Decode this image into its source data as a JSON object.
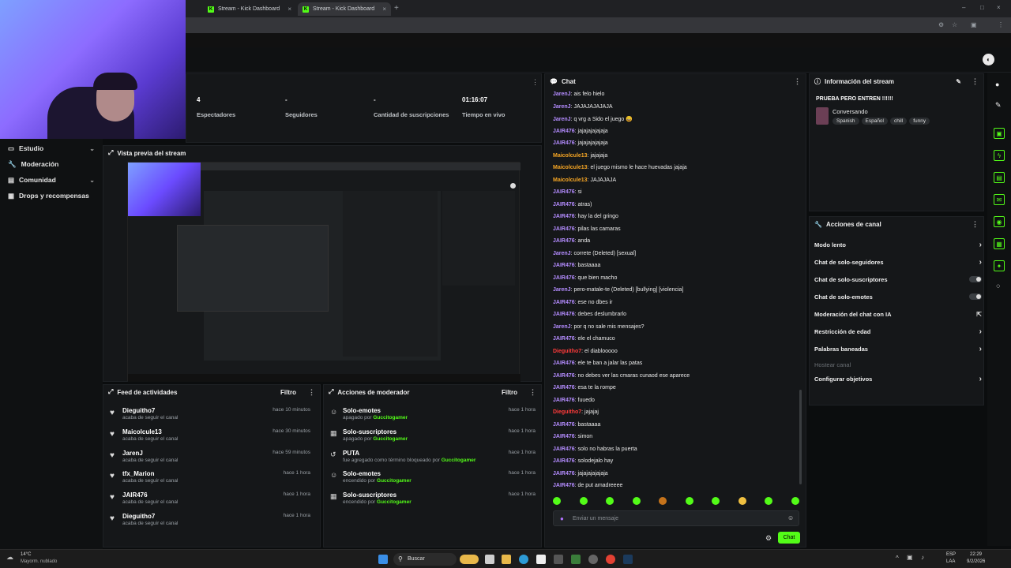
{
  "browser": {
    "tabs": [
      {
        "label": "Stream - Kick Dashboard"
      },
      {
        "label": "Stream - Kick Dashboard"
      }
    ]
  },
  "sidebar": {
    "items": [
      {
        "label": "Estudio",
        "chevron": "⌄"
      },
      {
        "label": "Moderación"
      },
      {
        "label": "Comunidad",
        "chevron": "⌄"
      },
      {
        "label": "Drops y recompensas"
      }
    ]
  },
  "stats": [
    {
      "value": "4",
      "label": "Espectadores"
    },
    {
      "value": "-",
      "label": "Seguidores"
    },
    {
      "value": "-",
      "label": "Cantidad de suscripciones"
    },
    {
      "value": "01:16:07",
      "label": "Tiempo en vivo"
    }
  ],
  "preview": {
    "title": "Vista previa del stream"
  },
  "feed": {
    "title": "Feed de actividades",
    "filter": "Filtro",
    "items": [
      {
        "name": "Dieguitho7",
        "sub": "acaba de seguir el canal",
        "time": "hace 10 minutos"
      },
      {
        "name": "Maicolcule13",
        "sub": "acaba de seguir el canal",
        "time": "hace 30 minutos"
      },
      {
        "name": "JarenJ",
        "sub": "acaba de seguir el canal",
        "time": "hace 59 minutos"
      },
      {
        "name": "tfx_Marion",
        "sub": "acaba de seguir el canal",
        "time": "hace 1 hora"
      },
      {
        "name": "JAIR476",
        "sub": "acaba de seguir el canal",
        "time": "hace 1 hora"
      },
      {
        "name": "Dieguitho7",
        "sub": "acaba de seguir el canal",
        "time": "hace 1 hora"
      }
    ]
  },
  "modactions": {
    "title": "Acciones de moderador",
    "filter": "Filtro",
    "items": [
      {
        "name": "Solo-emotes",
        "sub": "apagado por",
        "who": "Guccitogamer",
        "time": "hace 1 hora"
      },
      {
        "name": "Solo-suscriptores",
        "sub": "apagado por",
        "who": "Guccitogamer",
        "time": "hace 1 hora"
      },
      {
        "name": "PUTA",
        "sub": "fue agregado como término bloqueado por",
        "who": "Guccitogamer",
        "time": "hace 1 hora"
      },
      {
        "name": "Solo-emotes",
        "sub": "encendido por",
        "who": "Guccitogamer",
        "time": "hace 1 hora"
      },
      {
        "name": "Solo-suscriptores",
        "sub": "encendido por",
        "who": "Guccitogamer",
        "time": "hace 1 hora"
      }
    ]
  },
  "chat": {
    "title": "Chat",
    "placeholder": "Enviar un mensaje",
    "send": "Chat",
    "messages": [
      {
        "user": "JarenJ",
        "text": ": ais felo hielo",
        "color": "#b48cff"
      },
      {
        "user": "JarenJ",
        "text": ": JAJAJAJAJAJA",
        "color": "#b48cff"
      },
      {
        "user": "JarenJ",
        "text": ": q vrg a Sido el juego 😄",
        "color": "#b48cff"
      },
      {
        "user": "JAIR476",
        "text": ": jajajajajajaja",
        "color": "#b48cff"
      },
      {
        "user": "JAIR476",
        "text": ": jajajajajajaja",
        "color": "#b48cff"
      },
      {
        "user": "Maicolcule13",
        "text": ": jajajaja",
        "color": "#f5a524"
      },
      {
        "user": "Maicolcule13",
        "text": ": el juego mismo le hace huevadas jajaja",
        "color": "#f5a524"
      },
      {
        "user": "Maicolcule13",
        "text": ": JAJAJAJA",
        "color": "#f5a524"
      },
      {
        "user": "JAIR476",
        "text": ": si",
        "color": "#b48cff"
      },
      {
        "user": "JAIR476",
        "text": ": atras)",
        "color": "#b48cff"
      },
      {
        "user": "JAIR476",
        "text": ": hay la del gringo",
        "color": "#b48cff"
      },
      {
        "user": "JAIR476",
        "text": ": pilas las camaras",
        "color": "#b48cff"
      },
      {
        "user": "JAIR476",
        "text": ": anda",
        "color": "#b48cff"
      },
      {
        "user": "JarenJ",
        "text": ": correte (Deleted) [sexual]",
        "color": "#b48cff"
      },
      {
        "user": "JAIR476",
        "text": ": bastaaaa",
        "color": "#b48cff"
      },
      {
        "user": "JAIR476",
        "text": ": que bien macho",
        "color": "#b48cff"
      },
      {
        "user": "JarenJ",
        "text": ": pero-matale-te (Deleted) [bullying] [violencia]",
        "color": "#b48cff"
      },
      {
        "user": "JAIR476",
        "text": ": ese no dbes ir",
        "color": "#b48cff"
      },
      {
        "user": "JAIR476",
        "text": ": debes deslumbrarlo",
        "color": "#b48cff"
      },
      {
        "user": "JarenJ",
        "text": ": por q no sale mis mensajes?",
        "color": "#b48cff"
      },
      {
        "user": "JAIR476",
        "text": ": ele el chamuco",
        "color": "#b48cff"
      },
      {
        "user": "Dieguitho7",
        "text": ": el diablooooo",
        "color": "#ff3b3b"
      },
      {
        "user": "JAIR476",
        "text": ": ele te ban a jalar las patas",
        "color": "#b48cff"
      },
      {
        "user": "JAIR476",
        "text": ": no debes ver las cmaras cunaod ese aparece",
        "color": "#b48cff"
      },
      {
        "user": "JAIR476",
        "text": ": esa te la rompe",
        "color": "#b48cff"
      },
      {
        "user": "JAIR476",
        "text": ": fuuedo",
        "color": "#b48cff"
      },
      {
        "user": "Dieguitho7",
        "text": ": jajajaj",
        "color": "#ff3b3b"
      },
      {
        "user": "JAIR476",
        "text": ": bastaaaa",
        "color": "#b48cff"
      },
      {
        "user": "JAIR476",
        "text": ": simon",
        "color": "#b48cff"
      },
      {
        "user": "JAIR476",
        "text": ": solo no habras la puerta",
        "color": "#b48cff"
      },
      {
        "user": "JAIR476",
        "text": ": solodejalo hay",
        "color": "#b48cff"
      },
      {
        "user": "JAIR476",
        "text": ": jajajajajajaja",
        "color": "#b48cff"
      },
      {
        "user": "JAIR476",
        "text": ": de put amadreeee",
        "color": "#b48cff"
      }
    ]
  },
  "streaminfo": {
    "title": "Información del stream",
    "name": "PRUEBA PERO ENTREN !!!!!!",
    "category": "Conversando",
    "tags": [
      "Spanish",
      "Español",
      "chill",
      "funny"
    ]
  },
  "channel": {
    "title": "Acciones de canal",
    "items": [
      {
        "label": "Modo lento",
        "kind": "arrow"
      },
      {
        "label": "Chat de solo-seguidores",
        "kind": "arrow"
      },
      {
        "label": "Chat de solo-suscriptores",
        "kind": "toggle"
      },
      {
        "label": "Chat de solo-emotes",
        "kind": "toggle"
      },
      {
        "label": "Moderación del chat con IA",
        "kind": "ext"
      },
      {
        "label": "Restricción de edad",
        "kind": "arrow"
      },
      {
        "label": "Palabras baneadas",
        "kind": "arrow"
      },
      {
        "label": "Hostear canal",
        "kind": "none"
      },
      {
        "label": "Configurar objetivos",
        "kind": "arrow"
      }
    ]
  },
  "taskbar": {
    "weather": "14°C",
    "weather_desc": "Mayorm. nublado",
    "search": "Buscar",
    "lang": "ESP",
    "lang2": "LAA",
    "time": "22:29",
    "date": "9/2/2026"
  },
  "colors": {
    "accent": "#53fc18",
    "panel": "#151719"
  }
}
